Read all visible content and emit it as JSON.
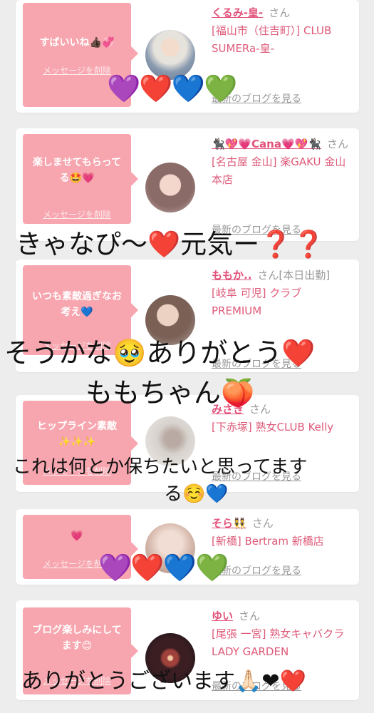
{
  "cards": [
    {
      "message": "すばいいね👍🏿💞",
      "delete_label": "メッセージを削除",
      "name": "くるみ-皇-",
      "honorific": "さん",
      "store": "[福山市（住吉町）] CLUB SUMERa-皇-",
      "blog_link": "最新のブログを見る"
    },
    {
      "message": "楽しませてもらってる🤩💗",
      "delete_label": "メッセージを削除",
      "name": "🐈‍⬛💖💗Cana💗💖🐈‍⬛",
      "honorific": "さん",
      "store": "[名古屋 金山] 楽GAKU 金山本店",
      "blog_link": "最新のブログを見る"
    },
    {
      "message": "いつも素敵過ぎなお考え💙",
      "delete_label": "メッセージを削除",
      "name": "ももか..",
      "honorific": "さん[本日出勤]",
      "store": "[岐阜 可児] クラブ PREMIUM",
      "blog_link": "最新のブログを見る"
    },
    {
      "message": "ヒップライン素敵✨✨✨",
      "delete_label": "メッセージを削除",
      "name": "みさき",
      "honorific": "さん",
      "store": "[下赤塚] 熟女CLUB Kelly",
      "blog_link": "最新のブログを見る"
    },
    {
      "message": "💗",
      "delete_label": "メッセージを削除",
      "name": "そら👯",
      "honorific": "さん",
      "store": "[新橋] Bertram 新橋店",
      "blog_link": "最新のブログを見る"
    },
    {
      "message": "ブログ楽しみにしてます😊",
      "delete_label": "メッセージを削除",
      "name": "ゆい",
      "honorific": "さん",
      "store": "[尾張 一宮] 熟女キャバクラ LADY GARDEN",
      "blog_link": "最新のブログを見る"
    }
  ],
  "overlays": {
    "hearts_row": "💜❤️💙💚",
    "caption_1": "きゃなぴ〜❤️元気ー❓❓",
    "caption_2_line1": "そうかな🥹ありがとう❤️",
    "caption_2_line2": "ももちゃん🍑",
    "caption_3_line1": "これは何とか保ちたいと思ってます",
    "caption_3_line2": "る☺️💙",
    "caption_4": "ありがとうございます🙏🏻❤❤️"
  }
}
